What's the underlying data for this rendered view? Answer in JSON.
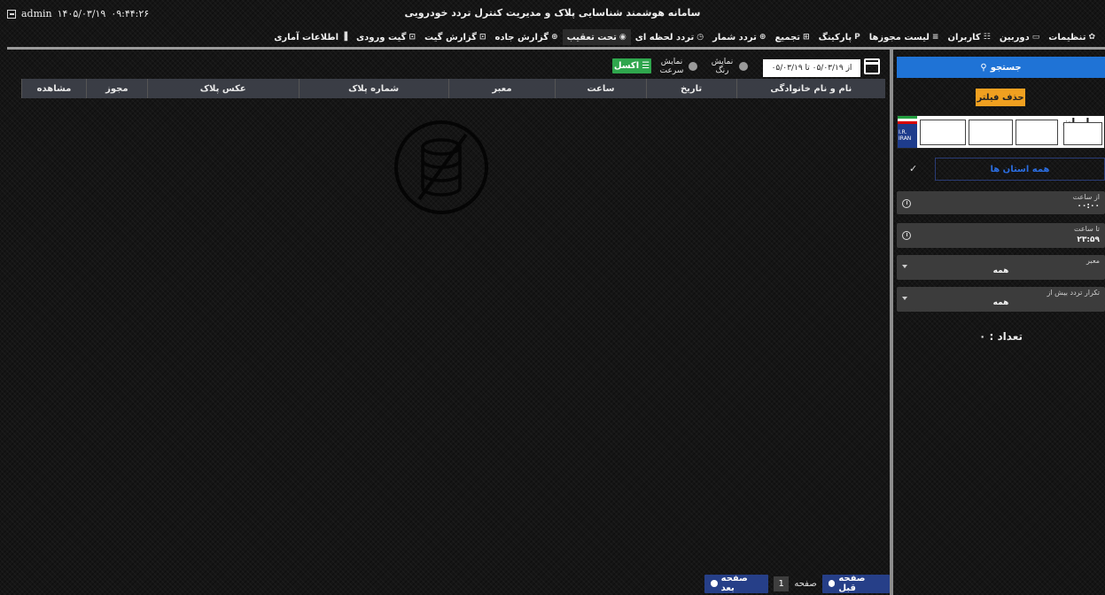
{
  "header": {
    "user": "admin",
    "date": "۱۴۰۵/۰۳/۱۹",
    "time": "۰۹:۴۴:۲۶",
    "app_title": "سامانه هوشمند شناسایی پلاک و مدیریت کنترل تردد خودرویی"
  },
  "nav": [
    {
      "label": "اطلاعات آماری",
      "icon": "bar-chart-icon"
    },
    {
      "label": "گیت ورودی",
      "icon": "login-icon"
    },
    {
      "label": "گزارش گیت",
      "icon": "login-icon"
    },
    {
      "label": "گزارش جاده",
      "icon": "circle-plus-icon"
    },
    {
      "label": "تحت تعقیب",
      "icon": "target-icon"
    },
    {
      "label": "تردد لحظه ای",
      "icon": "clock-icon"
    },
    {
      "label": "تردد شمار",
      "icon": "circle-plus-icon"
    },
    {
      "label": "تجمیع",
      "icon": "grid-icon"
    },
    {
      "label": "پارکینگ",
      "icon": "parking-icon"
    },
    {
      "label": "لیست مجوزها",
      "icon": "list-icon"
    },
    {
      "label": "کاربران",
      "icon": "users-icon"
    },
    {
      "label": "دوربین",
      "icon": "camera-icon"
    },
    {
      "label": "تنظیمات",
      "icon": "gear-icon"
    }
  ],
  "filters": {
    "date_range": "از ۰۵/۰۳/۱۹ تا ۰۵/۰۳/۱۹",
    "show_color": "نمایش رنگ",
    "show_speed": "نمایش سرعت",
    "excel": "اکسل"
  },
  "table": {
    "columns": [
      "نام و نام خانوادگی",
      "تاریخ",
      "ساعت",
      "معبر",
      "شماره پلاک",
      "عکس پلاک",
      "مجوز",
      "مشاهده"
    ]
  },
  "pagination": {
    "prev": "صفحه قبل",
    "page_label": "صفحه",
    "page_number": "1",
    "next": "صفحه بعد"
  },
  "sidebar": {
    "search": "جستجو",
    "clear_filter": "حذف فیلتر",
    "plate_country": "ایران",
    "plate_code": "I.R. IRAN",
    "province": "همه استان ها",
    "from_time_label": "از ساعت",
    "from_time_value": "۰۰:۰۰",
    "to_time_label": "تا ساعت",
    "to_time_value": "۲۳:۵۹",
    "passage_label": "معبر",
    "passage_value": "همه",
    "repeat_label": "تکرار تردد بیش از",
    "repeat_value": "همه",
    "count_text": "تعداد : ۰"
  },
  "colors": {
    "accent_blue": "#1f73d6",
    "excel_green": "#2fa64d",
    "clear_orange": "#f0a020",
    "pager_blue": "#263f88"
  }
}
